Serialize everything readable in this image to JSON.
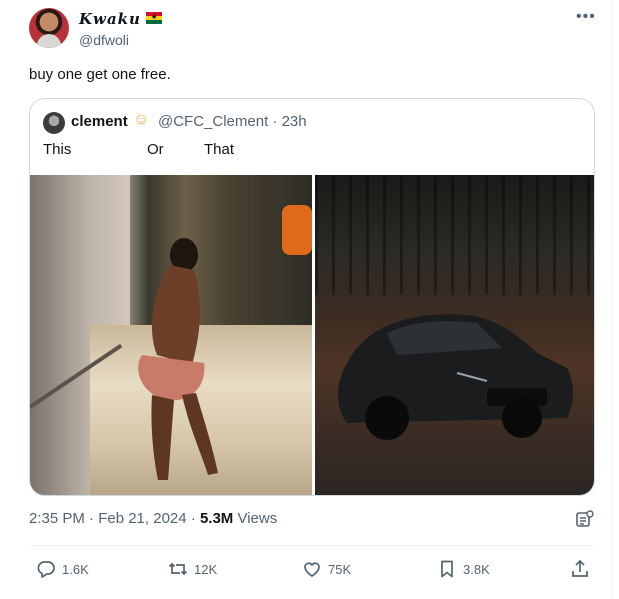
{
  "tweet": {
    "author_name": "Kwaku",
    "author_flag": "ghana-flag-icon",
    "handle": "@dfwoli",
    "text": "buy one get one free.",
    "timestamp": "2:35 PM · Feb 21, 2024 · ",
    "views_count": "5.3M",
    "views_label": " Views"
  },
  "quote": {
    "name": "clement",
    "emoji": "☺",
    "handle_time": "@CFC_Clement · 23h",
    "text_left": "This",
    "text_mid": "Or",
    "text_right": "That"
  },
  "actions": {
    "replies": "1.6K",
    "reposts": "12K",
    "likes": "75K",
    "bookmarks": "3.8K"
  },
  "colors": {
    "text": "#0f1419",
    "muted": "#536471",
    "border": "#cfd9de",
    "flag_red": "#ce1126",
    "flag_gold": "#fcd116",
    "flag_green": "#006b3f"
  }
}
